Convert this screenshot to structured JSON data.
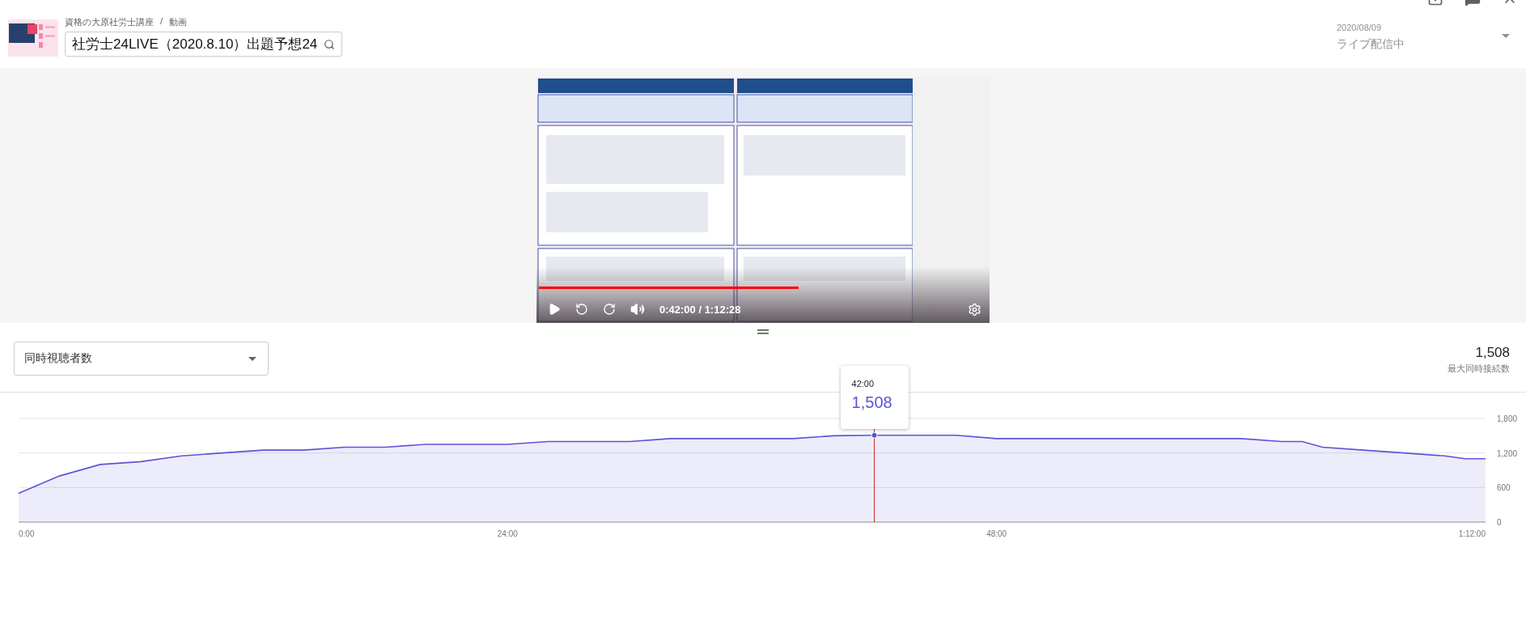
{
  "header": {
    "breadcrumb": [
      "資格の大原社労士講座",
      "動画"
    ],
    "separator": "/",
    "title": "社労士24LIVE（2020.8.10）出題予想24",
    "date": "2020/08/09",
    "status": "ライブ配信中"
  },
  "player": {
    "kind": "picture",
    "time": "0:42:00 / 1:12:28",
    "level": 0.58
  },
  "summary": {
    "value": "1,508",
    "label": "最大同時接続数"
  },
  "chart": {
    "tooltip": {
      "time": "42:00",
      "value": "1,508"
    },
    "chart_data": {
      "type": "area",
      "grid": true,
      "x": [
        0,
        2,
        4,
        6,
        8,
        10,
        12,
        14,
        16,
        18,
        20,
        22,
        24,
        26,
        28,
        30,
        32,
        34,
        36,
        38,
        40,
        42,
        44,
        46,
        48,
        50,
        52,
        54,
        56,
        58,
        60,
        62,
        63,
        64,
        66,
        68,
        70,
        71,
        72
      ],
      "series": [
        {
          "name": "同時視聴者数",
          "color": "#5c53d9",
          "values": [
            500,
            800,
            1000,
            1050,
            1150,
            1200,
            1250,
            1250,
            1300,
            1300,
            1350,
            1350,
            1350,
            1400,
            1400,
            1400,
            1450,
            1450,
            1450,
            1450,
            1500,
            1508,
            1508,
            1508,
            1450,
            1450,
            1450,
            1450,
            1450,
            1450,
            1450,
            1400,
            1400,
            1300,
            1250,
            1200,
            1150,
            1100,
            1100
          ]
        }
      ],
      "xlim": [
        0,
        72
      ],
      "ylim": [
        0,
        1800
      ],
      "ref_lines": [
        {
          "axis": "x",
          "value": 42,
          "color": "#c62828"
        }
      ],
      "xticks": [
        {
          "value": 0,
          "label": "0:00"
        },
        {
          "value": 24,
          "label": "24:00"
        },
        {
          "value": 48,
          "label": "48:00"
        },
        {
          "value": 72,
          "label": "1:12:00"
        }
      ],
      "yticks": [
        {
          "value": 0,
          "label": "0"
        },
        {
          "value": 600,
          "label": "600"
        },
        {
          "value": 1200,
          "label": "1,200"
        },
        {
          "value": 1800,
          "label": "1,800"
        }
      ]
    }
  }
}
